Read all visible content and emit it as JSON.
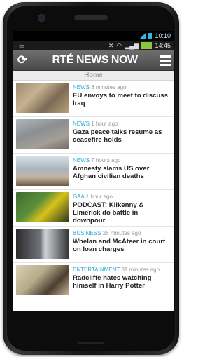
{
  "status": {
    "top_time": "10:10",
    "time": "14:45"
  },
  "appbar": {
    "logo": "RTÉ NEWS NOW",
    "refresh_glyph": "⟳"
  },
  "section": {
    "title": "Home"
  },
  "articles": [
    {
      "category": "NEWS",
      "time": "3 minutes ago",
      "headline": "EU envoys to meet to discuss Iraq"
    },
    {
      "category": "NEWS",
      "time": "1 hour ago",
      "headline": "Gaza peace talks resume as ceasefire holds"
    },
    {
      "category": "NEWS",
      "time": "7 hours ago",
      "headline": "Amnesty slams US over Afghan civilian deaths"
    },
    {
      "category": "GAA",
      "time": "1 hour ago",
      "headline": "PODCAST: Kilkenny & Limerick do battle in downpour"
    },
    {
      "category": "BUSINESS",
      "time": "26 minutes ago",
      "headline": "Whelan and McAteer in court on loan charges"
    },
    {
      "category": "ENTERTAINMENT",
      "time": "31 minutes ago",
      "headline": "Radcliffe hates watching himself in Harry Potter"
    }
  ],
  "icons": {
    "refresh": "refresh-icon",
    "menu": "menu-icon",
    "signal": "signal-icon",
    "wifi": "wifi-icon",
    "battery": "battery-icon"
  },
  "colors": {
    "accent": "#2aa8d8",
    "appbar": "#5a5a5a",
    "battery": "#8cc63f"
  }
}
